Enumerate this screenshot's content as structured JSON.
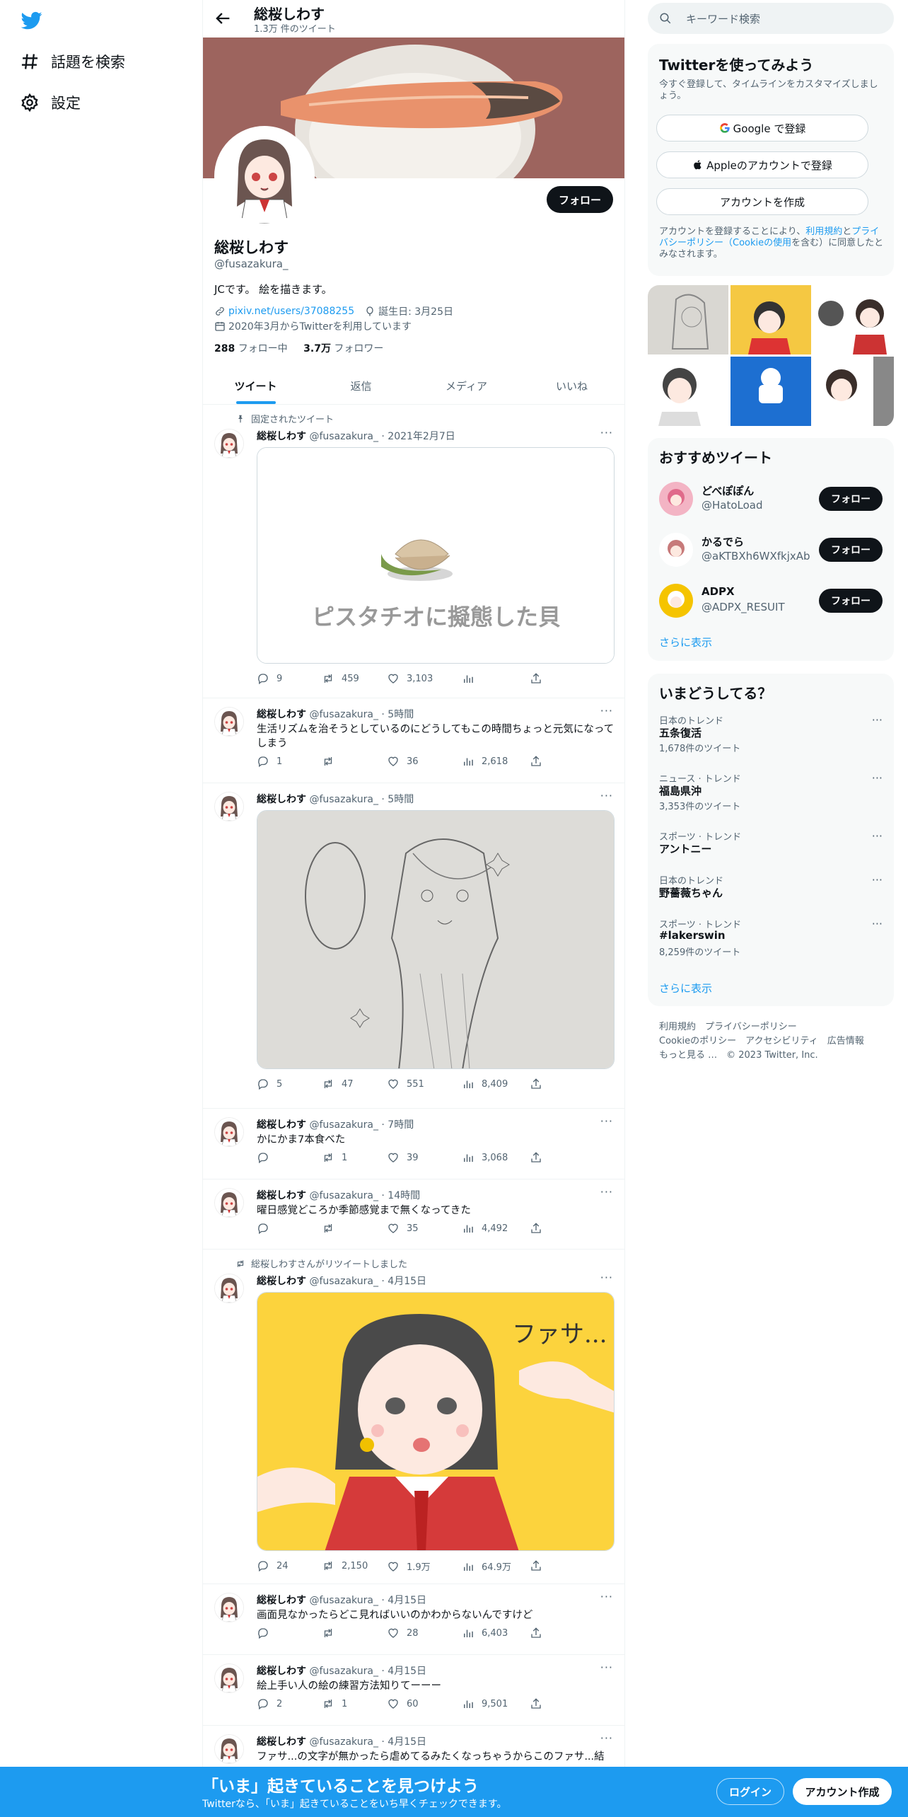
{
  "nav": {
    "items": [
      {
        "label": "話題を検索",
        "icon": "hashtag-icon"
      },
      {
        "label": "設定",
        "icon": "gear-icon"
      }
    ]
  },
  "header": {
    "title": "総桜しわす",
    "subtitle": "1.3万 件のツイート"
  },
  "profile": {
    "name": "総桜しわす",
    "handle": "@fusazakura_",
    "bio": "JCです。 絵を描きます。",
    "link": "pixiv.net/users/37088255",
    "birthday": "誕生日: 3月25日",
    "joined": "2020年3月からTwitterを利用しています",
    "following_count": "288",
    "following_label": "フォロー中",
    "followers_count": "3.7万",
    "followers_label": "フォロワー",
    "follow_label": "フォロー"
  },
  "tabs": [
    "ツイート",
    "返信",
    "メディア",
    "いいね"
  ],
  "tweets": [
    {
      "context": "固定されたツイート",
      "name": "総桜しわす",
      "handle": "@fusazakura_",
      "time": "· 2021年2月7日",
      "text": "",
      "media_caption": "ピスタチオに擬態した貝",
      "reply": "9",
      "retweet": "459",
      "like": "3,103",
      "views": ""
    },
    {
      "context": "",
      "name": "総桜しわす",
      "handle": "@fusazakura_",
      "time": "· 5時間",
      "text": "生活リズムを治そうとしているのにどうしてもこの時間ちょっと元気になってしまう",
      "reply": "1",
      "retweet": "",
      "like": "36",
      "views": "2,618"
    },
    {
      "context": "",
      "name": "総桜しわす",
      "handle": "@fusazakura_",
      "time": "· 5時間",
      "text": "",
      "reply": "5",
      "retweet": "47",
      "like": "551",
      "views": "8,409"
    },
    {
      "context": "",
      "name": "総桜しわす",
      "handle": "@fusazakura_",
      "time": "· 7時間",
      "text": "かにかま7本食べた",
      "reply": "",
      "retweet": "1",
      "like": "39",
      "views": "3,068"
    },
    {
      "context": "",
      "name": "総桜しわす",
      "handle": "@fusazakura_",
      "time": "· 14時間",
      "text": "曜日感覚どころか季節感覚まで無くなってきた",
      "reply": "",
      "retweet": "",
      "like": "35",
      "views": "4,492"
    },
    {
      "context": "総桜しわすさんがリツイートしました",
      "name": "総桜しわす",
      "handle": "@fusazakura_",
      "time": "· 4月15日",
      "text": "",
      "media_caption": "ファサ...",
      "reply": "24",
      "retweet": "2,150",
      "like": "1.9万",
      "views": "64.9万"
    },
    {
      "context": "",
      "name": "総桜しわす",
      "handle": "@fusazakura_",
      "time": "· 4月15日",
      "text": "画面見なかったらどこ見ればいいのかわからないんですけど",
      "reply": "",
      "retweet": "",
      "like": "28",
      "views": "6,403"
    },
    {
      "context": "",
      "name": "総桜しわす",
      "handle": "@fusazakura_",
      "time": "· 4月15日",
      "text": "絵上手い人の絵の練習方法知りてーーー",
      "reply": "2",
      "retweet": "1",
      "like": "60",
      "views": "9,501"
    },
    {
      "context": "",
      "name": "総桜しわす",
      "handle": "@fusazakura_",
      "time": "· 4月15日",
      "text": "ファサ...の文字が無かったら虐めてるみたくなっちゃうからこのファサ...結",
      "reply": "",
      "retweet": "",
      "like": "",
      "views": ""
    }
  ],
  "search": {
    "placeholder": "キーワード検索"
  },
  "signup": {
    "title": "Twitterを使ってみよう",
    "sub": "今すぐ登録して、タイムラインをカスタマイズしましょう。",
    "google": "Google で登録",
    "apple": "Appleのアカウントで登録",
    "create": "アカウントを作成",
    "legal_a": "アカウントを登録することにより、",
    "legal_terms": "利用規約",
    "legal_and": "と",
    "legal_privacy": "プライバシーポリシー",
    "legal_cookie": "（Cookieの使用",
    "legal_b": "を含む）に同意したとみなされます。"
  },
  "recommend": {
    "title": "おすすめツイート",
    "users": [
      {
        "name": "どべぽぽん",
        "handle": "@HatoLoad"
      },
      {
        "name": "かるでら",
        "handle": "@aKTBXh6WXfkjxAb"
      },
      {
        "name": "ADPX",
        "handle": "@ADPX_RESUIT"
      }
    ],
    "follow_label": "フォロー",
    "more": "さらに表示"
  },
  "trends": {
    "title": "いまどうしてる？",
    "items": [
      {
        "cat": "日本のトレンド",
        "name": "五条復活",
        "count": "1,678件のツイート"
      },
      {
        "cat": "ニュース · トレンド",
        "name": "福島県沖",
        "count": "3,353件のツイート"
      },
      {
        "cat": "スポーツ · トレンド",
        "name": "アントニー",
        "count": ""
      },
      {
        "cat": "日本のトレンド",
        "name": "野薔薇ちゃん",
        "count": ""
      },
      {
        "cat": "スポーツ · トレンド",
        "name": "#lakerswin",
        "count": "8,259件のツイート"
      }
    ],
    "more": "さらに表示"
  },
  "footer": {
    "line1": "利用規約　プライバシーポリシー",
    "line2": "Cookieのポリシー　アクセシビリティ　広告情報",
    "line3": "もっと見る …　© 2023 Twitter, Inc."
  },
  "bottom": {
    "title": "「いま」起きていることを見つけよう",
    "sub": "Twitterなら、「いま」起きていることをいち早くチェックできます。",
    "login": "ログイン",
    "signup": "アカウント作成"
  },
  "colors": {
    "accent": "#1d9bf0",
    "dark": "#0f1419",
    "muted": "#536471"
  }
}
